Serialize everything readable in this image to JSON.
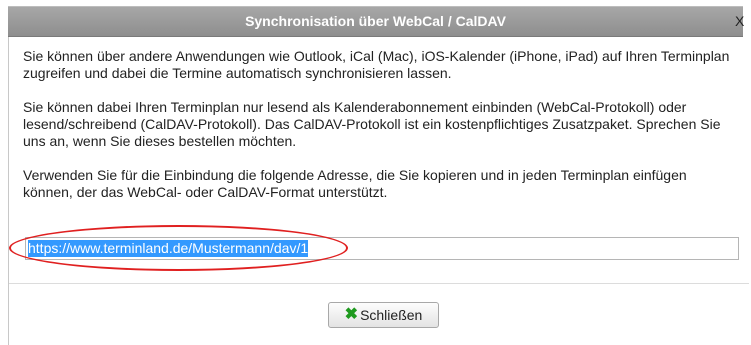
{
  "dialog": {
    "title": "Synchronisation über WebCal / CalDAV",
    "close_glyph": "X"
  },
  "content": {
    "paragraph1": "Sie können über andere Anwendungen wie Outlook, iCal (Mac), iOS-Kalender (iPhone, iPad) auf Ihren Terminplan zugreifen und dabei die Termine automatisch synchronisieren lassen.",
    "paragraph2": "Sie können dabei Ihren Terminplan nur lesend als Kalenderabonnement einbinden (WebCal-Protokoll) oder lesend/schreibend (CalDAV-Protokoll). Das CalDAV-Protokoll ist ein kostenpflichtiges Zusatzpaket. Sprechen Sie uns an, wenn Sie dieses bestellen möchten.",
    "paragraph3": "Verwenden Sie für die Einbindung die folgende Adresse, die Sie kopieren und in jeden Terminplan einfügen können, der das WebCal- oder CalDAV-Format unterstützt."
  },
  "url_field": {
    "value": "https://www.terminland.de/Mustermann/dav/1",
    "selected": true
  },
  "footer": {
    "close_label": "Schließen",
    "close_icon": "green-x-icon"
  },
  "colors": {
    "titlebar": "#999999",
    "selection": "#3399ff",
    "annotation": "#e02020",
    "icon_green": "#1e9a1e"
  }
}
